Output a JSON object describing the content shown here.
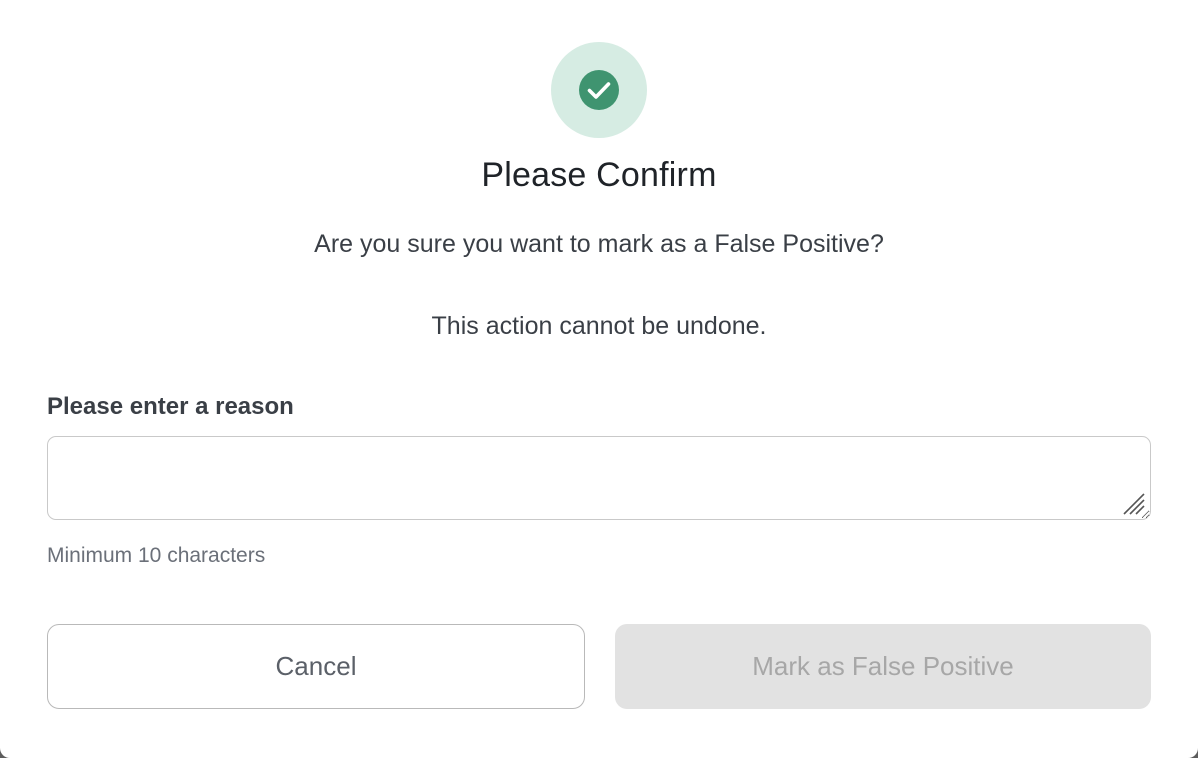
{
  "dialog": {
    "title": "Please Confirm",
    "question": "Are you sure you want to mark as a False Positive?",
    "warning": "This action cannot be undone.",
    "status_icon": "check-circle-icon",
    "colors": {
      "accent": "#3f9470",
      "accent_bg": "#d6ece3",
      "disabled_bg": "#e2e2e2",
      "disabled_text": "#a7a7a7"
    }
  },
  "reason": {
    "label": "Please enter a reason",
    "value": "",
    "helper": "Minimum 10 characters"
  },
  "actions": {
    "cancel_label": "Cancel",
    "confirm_label": "Mark as False Positive",
    "confirm_disabled": true
  }
}
